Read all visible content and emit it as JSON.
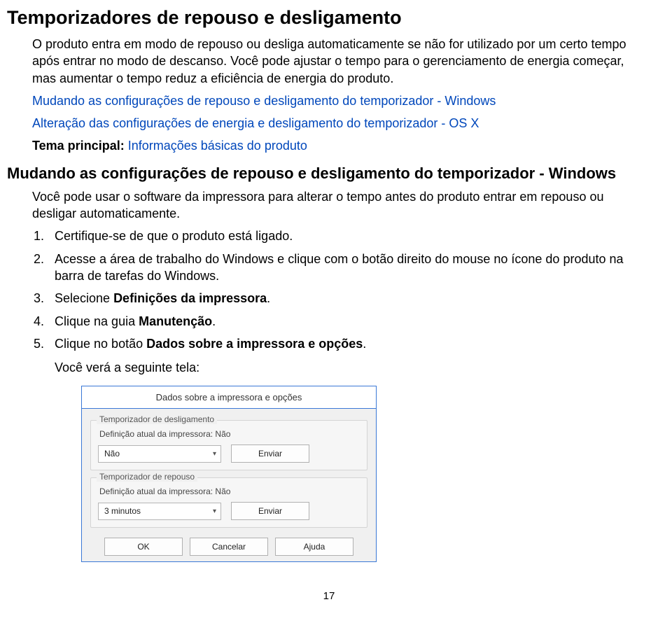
{
  "heading1": "Temporizadores de repouso e desligamento",
  "para1": "O produto entra em modo de repouso ou desliga automaticamente se não for utilizado por um certo tempo após entrar no modo de descanso. Você pode ajustar o tempo para o gerenciamento de energia começar, mas aumentar o tempo reduz a eficiência de energia do produto.",
  "link1": "Mudando as configurações de repouso e desligamento do temporizador - Windows",
  "link2": "Alteração das configurações de energia e desligamento do temporizador - OS X",
  "tema_label": "Tema principal:",
  "tema_value": "Informações básicas do produto",
  "heading2": "Mudando as configurações de repouso e desligamento do temporizador - Windows",
  "para2": "Você pode usar o software da impressora para alterar o tempo antes do produto entrar em repouso ou desligar automaticamente.",
  "steps": [
    "Certifique-se de que o produto está ligado.",
    "Acesse a área de trabalho do Windows e clique com o botão direito do mouse no ícone do produto na barra de tarefas do Windows.",
    "Selecione Definições da impressora.",
    "Clique na guia Manutenção.",
    "Clique no botão Dados sobre a impressora e opções."
  ],
  "bold_in_steps": {
    "2": "Definições da impressora",
    "3": "Manutenção",
    "4": "Dados sobre a impressora e opções"
  },
  "after_steps": "Você verá a seguinte tela:",
  "dialog": {
    "title": "Dados sobre a impressora e opções",
    "group1_title": "Temporizador de desligamento",
    "group1_def": "Definição atual da impressora: Não",
    "group1_value": "Não",
    "group2_title": "Temporizador de repouso",
    "group2_def": "Definição atual da impressora: Não",
    "group2_value": "3 minutos",
    "btn_send": "Enviar",
    "btn_ok": "OK",
    "btn_cancel": "Cancelar",
    "btn_help": "Ajuda"
  },
  "page_number": "17"
}
